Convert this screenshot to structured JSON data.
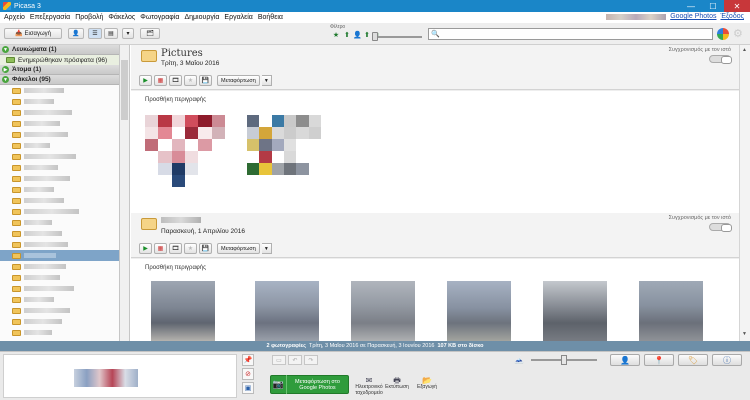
{
  "window": {
    "title": "Picasa 3",
    "minimize": "—",
    "maximize": "☐",
    "close": "✕"
  },
  "menubar": {
    "items": [
      "Αρχείο",
      "Επεξεργασία",
      "Προβολή",
      "Φάκελος",
      "Φωτογραφία",
      "Δημιουργία",
      "Εργαλεία",
      "Βοήθεια"
    ],
    "google_photos_link": "Google Photos",
    "signout_link": "Έξοδος"
  },
  "toolbar": {
    "import_label": "Εισαγωγή",
    "filter_label": "Φίλτρο",
    "search_placeholder": ""
  },
  "sidebar": {
    "albums_header": "Λευκώματα (1)",
    "albums_item": "Ενημερώθηκαν πρόσφατα (96)",
    "people_header": "Άτομα (1)",
    "folders_header": "Φάκελοι (95)"
  },
  "albums": [
    {
      "name": "Pictures",
      "date": "Τρίτη, 3 Μαΐου 2016",
      "sync_label": "Συγχρονισμός με τον ιστό",
      "upload_label": "Μεταφόρτωση",
      "add_description": "Προσθήκη περιγραφής"
    },
    {
      "name": "",
      "date": "Παρασκευή, 1 Απριλίου 2016",
      "sync_label": "Συγχρονισμός με τον ιστό",
      "upload_label": "Μεταφόρτωση",
      "add_description": "Προσθήκη περιγραφής"
    }
  ],
  "status": {
    "count": "2 φωτογραφίες",
    "date_range": "Τρίτη, 3 Μαΐου 2016 σε Παρασκευή, 3 Ιουνίου 2016",
    "size": "107 KB στο δίσκο"
  },
  "tray": {
    "google_photos_button": "Μεταφόρτωση στο Google Photos",
    "email_label": "Ηλεκτρονικό ταχυδρομείο",
    "print_label": "Εκτύπωση",
    "export_label": "Εξαγωγή"
  },
  "colors": {
    "titlebar": "#1a86c8",
    "statusbar": "#6e8fa8",
    "upload_green": "#2f9c3c",
    "selected_folder": "#7ea4c8"
  }
}
